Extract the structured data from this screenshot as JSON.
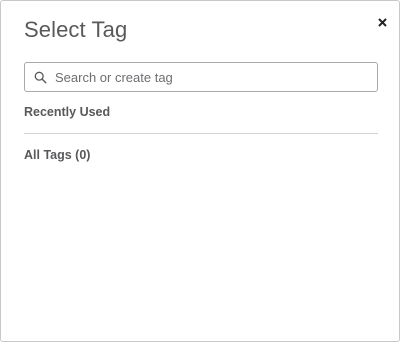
{
  "dialog": {
    "title": "Select Tag",
    "close_icon": "close-icon"
  },
  "search": {
    "icon": "search-icon",
    "placeholder": "Search or create tag",
    "value": ""
  },
  "sections": {
    "recently_used": "Recently Used",
    "all_tags": "All Tags (0)"
  },
  "colors": {
    "text": "#58595b",
    "border": "#a7a9ac",
    "divider": "#d1d3d4",
    "icon": "#222222"
  }
}
